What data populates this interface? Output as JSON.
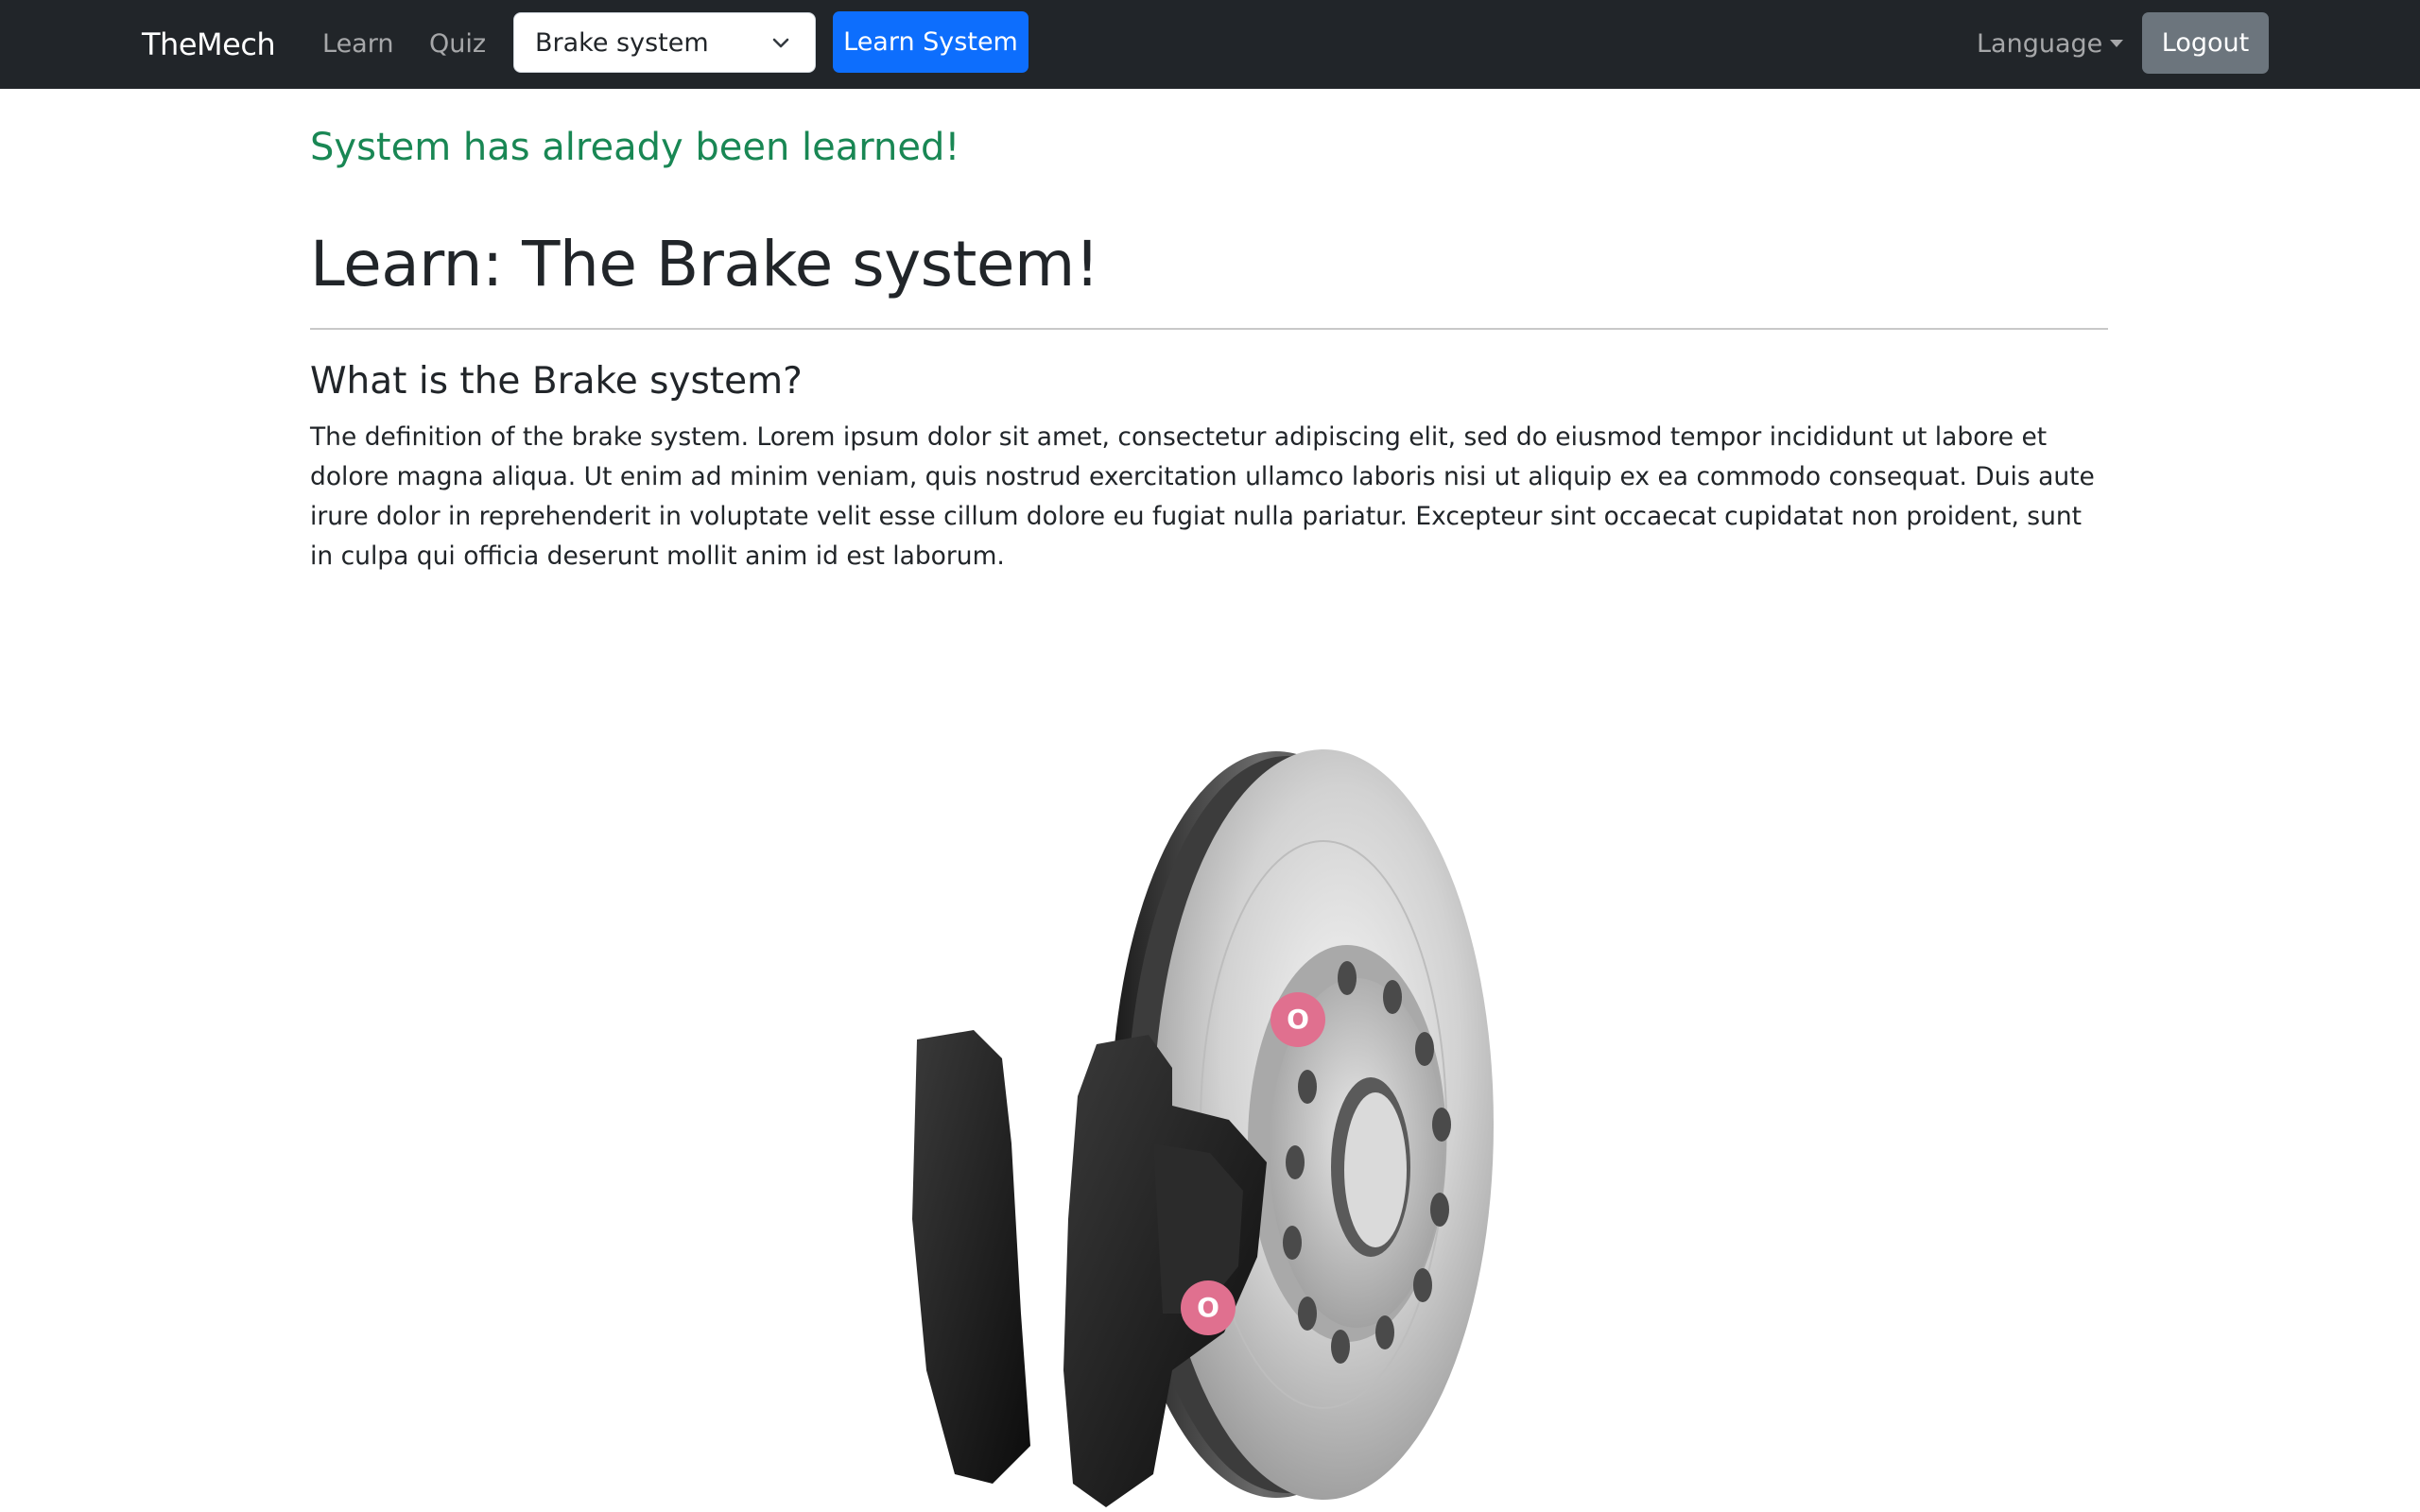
{
  "navbar": {
    "brand": "TheMech",
    "links": {
      "learn": "Learn",
      "quiz": "Quiz"
    },
    "system_select": {
      "value": "Brake system"
    },
    "learn_system_button": "Learn System",
    "language_toggle": "Language",
    "logout_button": "Logout"
  },
  "content": {
    "status_message": "System has already been learned!",
    "title": "Learn: The Brake system!",
    "section_title": "What is the Brake system?",
    "definition": "The definition of the brake system. Lorem ipsum dolor sit amet, consectetur adipiscing elit, sed do eiusmod tempor incididunt ut labore et dolore magna aliqua. Ut enim ad minim veniam, quis nostrud exercitation ullamco laboris nisi ut aliquip ex ea commodo consequat. Duis aute irure dolor in reprehenderit in voluptate velit esse cillum dolore eu fugiat nulla pariatur. Excepteur sint occaecat cupidatat non proident, sunt in culpa qui officia deserunt mollit anim id est laborum."
  },
  "figure": {
    "hotspots": [
      {
        "label": "O"
      },
      {
        "label": "O"
      }
    ]
  },
  "colors": {
    "navbar_bg": "#212529",
    "primary": "#0d6efd",
    "secondary": "#6c757d",
    "success": "#198754",
    "hotspot": "#e0708f"
  }
}
